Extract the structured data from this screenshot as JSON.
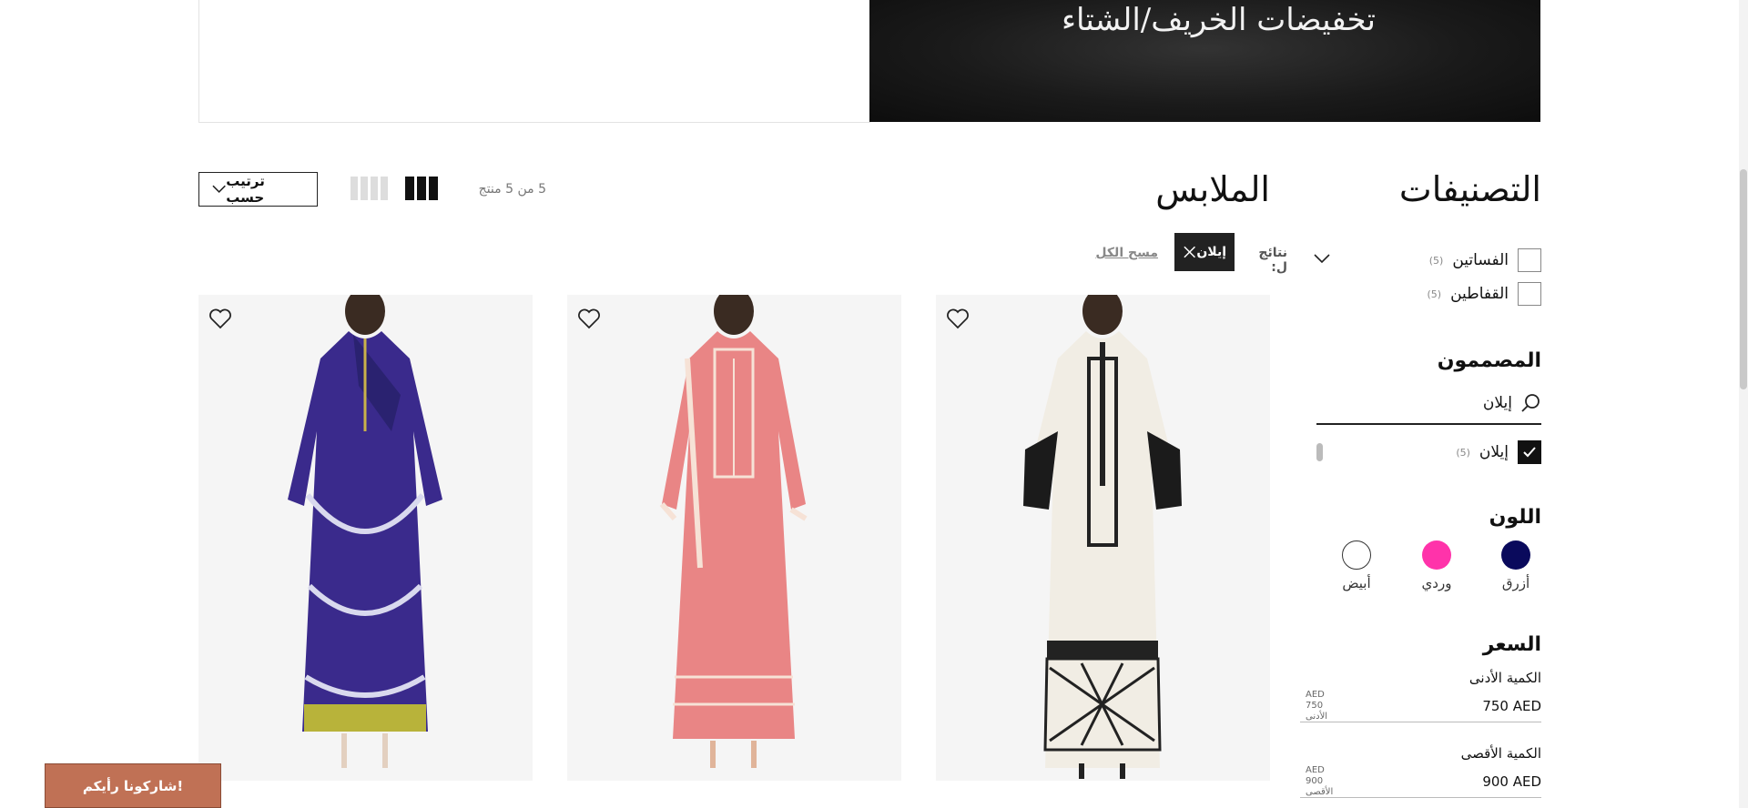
{
  "banner": {
    "title": "تخفيضات الخريف/الشتاء"
  },
  "toolbar": {
    "sort_label": "ترتيب حسب",
    "count": "5 من 5 منتج"
  },
  "headings": {
    "section_title": "الملابس",
    "categories_title": "التصنيفات"
  },
  "active_filters": {
    "results_label": "نتائج ل:",
    "chip_label": "إيلان",
    "clear_all": "مسح الكل"
  },
  "categories": [
    {
      "label": "الفساتين",
      "count": "(5)",
      "checked": false
    },
    {
      "label": "القفاطين",
      "count": "(5)",
      "checked": false
    }
  ],
  "designers": {
    "heading": "المصممون",
    "search_value": "إيلان",
    "items": [
      {
        "label": "إيلان",
        "count": "(5)",
        "checked": true
      }
    ]
  },
  "colors": {
    "heading": "اللون",
    "items": [
      {
        "label": "أزرق",
        "hex": "#0a0a5c"
      },
      {
        "label": "وردي",
        "hex": "#ff33aa"
      },
      {
        "label": "أبيض",
        "hex": "#ffffff"
      }
    ]
  },
  "price": {
    "heading": "السعر",
    "min_label": "الكمية الأدنى",
    "min_value": "750 AED",
    "min_hint_currency": "AED",
    "min_hint_value": "750",
    "min_hint_label": "الأدنى",
    "max_label": "الكمية الأقصى",
    "max_value": "900 AED",
    "max_hint_currency": "AED",
    "max_hint_value": "900",
    "max_hint_label": "الأقصى"
  },
  "products": [
    {
      "dress_color": "#f1ede4",
      "pattern_color": "#222222"
    },
    {
      "dress_color": "#e98585",
      "pattern_color": "#f6e2d6"
    },
    {
      "dress_color": "#3a2a8c",
      "pattern_color": "#d9d9ee"
    }
  ],
  "feedback": {
    "label": "شاركونا رأيكم!"
  }
}
